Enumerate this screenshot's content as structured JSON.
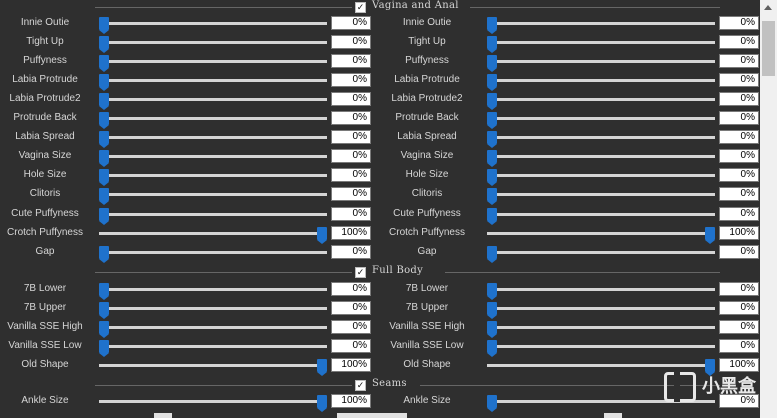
{
  "sections": {
    "vagina_anal": {
      "label": "Vagina and Anal",
      "checked": true
    },
    "full_body": {
      "label": "Full Body",
      "checked": true
    },
    "seams": {
      "label": "Seams",
      "checked": true
    }
  },
  "left_panel": {
    "vagina_anal": [
      {
        "label": "Innie Outie",
        "value": "0%",
        "level": 0
      },
      {
        "label": "Tight Up",
        "value": "0%",
        "level": 0
      },
      {
        "label": "Puffyness",
        "value": "0%",
        "level": 0
      },
      {
        "label": "Labia Protrude",
        "value": "0%",
        "level": 0
      },
      {
        "label": "Labia Protrude2",
        "value": "0%",
        "level": 0
      },
      {
        "label": "Protrude Back",
        "value": "0%",
        "level": 0
      },
      {
        "label": "Labia Spread",
        "value": "0%",
        "level": 0
      },
      {
        "label": "Vagina Size",
        "value": "0%",
        "level": 0
      },
      {
        "label": "Hole Size",
        "value": "0%",
        "level": 0
      },
      {
        "label": "Clitoris",
        "value": "0%",
        "level": 0
      },
      {
        "label": "Cute Puffyness",
        "value": "0%",
        "level": 0
      },
      {
        "label": "Crotch Puffyness",
        "value": "100%",
        "level": 1
      },
      {
        "label": "Gap",
        "value": "0%",
        "level": 0
      }
    ],
    "full_body": [
      {
        "label": "7B Lower",
        "value": "0%",
        "level": 0
      },
      {
        "label": "7B Upper",
        "value": "0%",
        "level": 0
      },
      {
        "label": "Vanilla SSE High",
        "value": "0%",
        "level": 0
      },
      {
        "label": "Vanilla SSE Low",
        "value": "0%",
        "level": 0
      },
      {
        "label": "Old Shape",
        "value": "100%",
        "level": 1
      }
    ],
    "seams": [
      {
        "label": "Ankle Size",
        "value": "100%",
        "level": 1
      }
    ]
  },
  "right_panel": {
    "vagina_anal": [
      {
        "label": "Innie Outie",
        "value": "0%",
        "level": 0
      },
      {
        "label": "Tight Up",
        "value": "0%",
        "level": 0
      },
      {
        "label": "Puffyness",
        "value": "0%",
        "level": 0
      },
      {
        "label": "Labia Protrude",
        "value": "0%",
        "level": 0
      },
      {
        "label": "Labia Protrude2",
        "value": "0%",
        "level": 0
      },
      {
        "label": "Protrude Back",
        "value": "0%",
        "level": 0
      },
      {
        "label": "Labia Spread",
        "value": "0%",
        "level": 0
      },
      {
        "label": "Vagina Size",
        "value": "0%",
        "level": 0
      },
      {
        "label": "Hole Size",
        "value": "0%",
        "level": 0
      },
      {
        "label": "Clitoris",
        "value": "0%",
        "level": 0
      },
      {
        "label": "Cute Puffyness",
        "value": "0%",
        "level": 0
      },
      {
        "label": "Crotch Puffyness",
        "value": "100%",
        "level": 1
      },
      {
        "label": "Gap",
        "value": "0%",
        "level": 0
      }
    ],
    "full_body": [
      {
        "label": "7B Lower",
        "value": "0%",
        "level": 0
      },
      {
        "label": "7B Upper",
        "value": "0%",
        "level": 0
      },
      {
        "label": "Vanilla SSE High",
        "value": "0%",
        "level": 0
      },
      {
        "label": "Vanilla SSE Low",
        "value": "0%",
        "level": 0
      },
      {
        "label": "Old Shape",
        "value": "100%",
        "level": 1
      }
    ],
    "seams": [
      {
        "label": "Ankle Size",
        "value": "0%",
        "level": 0
      }
    ]
  },
  "watermark": {
    "text": "小黑盒"
  },
  "colors": {
    "background": "#2f2f2f",
    "accent": "#1f72cc",
    "track": "#d4d4d4",
    "text": "#d6d6d6"
  },
  "icons": {
    "section_checkbox": "checkmark-icon",
    "scroll_up": "scroll-up-arrow-icon",
    "watermark_logo": "heybox-logo-icon"
  }
}
